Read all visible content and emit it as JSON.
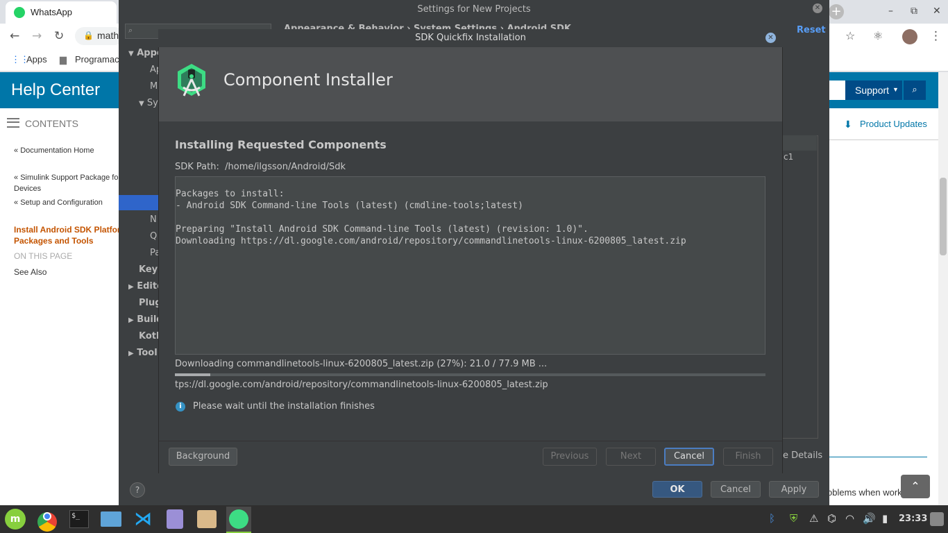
{
  "browser": {
    "tab_title": "WhatsApp",
    "url_partial": "math",
    "bookmarks": [
      "Apps",
      "Programac"
    ],
    "back_icon": "←",
    "forward_icon": "→",
    "reload_icon": "↻",
    "new_tab_icon": "+"
  },
  "help_page": {
    "header": "Help Center",
    "contents_label": "CONTENTS",
    "nav": [
      {
        "label": "Documentation Home",
        "arrow": "«"
      },
      {
        "label": "Simulink Support Package for",
        "label2": "Devices",
        "arrow": "«"
      },
      {
        "label": "Setup and Configuration",
        "arrow": "«"
      }
    ],
    "current_line1": "Install Android SDK Platfor",
    "current_line2": "Packages and Tools",
    "on_this_page": "ON THIS PAGE",
    "see_also": "See Also",
    "support_label": "Support",
    "product_updates": "Product Updates",
    "partial_e": "e",
    "partial_problems": "oblems when work",
    "to_top_icon": "⌃"
  },
  "settings": {
    "title": "Settings for New Projects",
    "breadcrumb": "Appearance & Behavior  ›  System Settings  ›  Android SDK",
    "reset": "Reset",
    "tree": [
      {
        "label": "Appe",
        "arrow": "▼",
        "bold": true
      },
      {
        "label": "Ap"
      },
      {
        "label": "M"
      },
      {
        "label": "Sy",
        "arrow": "▼"
      },
      {
        "label": "N"
      },
      {
        "label": "Q"
      },
      {
        "label": "Pa"
      },
      {
        "label": "Keyn",
        "bold": true
      },
      {
        "label": "Edito",
        "arrow": "▶",
        "bold": true
      },
      {
        "label": "Plug",
        "bold": true
      },
      {
        "label": "Build",
        "arrow": "▶",
        "bold": true
      },
      {
        "label": "Kotl",
        "bold": true
      },
      {
        "label": "Tool",
        "arrow": "▶",
        "bold": true
      }
    ],
    "partial_c1": "c1",
    "partial_details": "e Details",
    "ok": "OK",
    "cancel": "Cancel",
    "apply": "Apply",
    "help": "?"
  },
  "dialog": {
    "title": "SDK Quickfix Installation",
    "header": "Component Installer",
    "section_title": "Installing Requested Components",
    "sdk_path_label": "SDK Path:",
    "sdk_path": "/home/ilgsson/Android/Sdk",
    "console_lines": [
      "Packages to install:",
      "- Android SDK Command-line Tools (latest) (cmdline-tools;latest)",
      "",
      "Preparing \"Install Android SDK Command-line Tools (latest) (revision: 1.0)\".",
      "Downloading https://dl.google.com/android/repository/commandlinetools-linux-6200805_latest.zip"
    ],
    "progress_text": "Downloading commandlinetools-linux-6200805_latest.zip (27%): 21.0 / 77.9 MB ...",
    "progress_fraction": 0.06,
    "progress_url": "tps://dl.google.com/android/repository/commandlinetools-linux-6200805_latest.zip",
    "wait_text": "Please wait until the installation finishes",
    "info_icon": "i",
    "buttons": {
      "background": "Background",
      "previous": "Previous",
      "next": "Next",
      "cancel": "Cancel",
      "finish": "Finish"
    }
  },
  "taskbar": {
    "clock": "23:33"
  },
  "colors": {
    "accent_blue": "#0076a8",
    "current_page_orange": "#c45400",
    "ide_bg": "#3c3f41",
    "ide_ok": "#365880"
  }
}
